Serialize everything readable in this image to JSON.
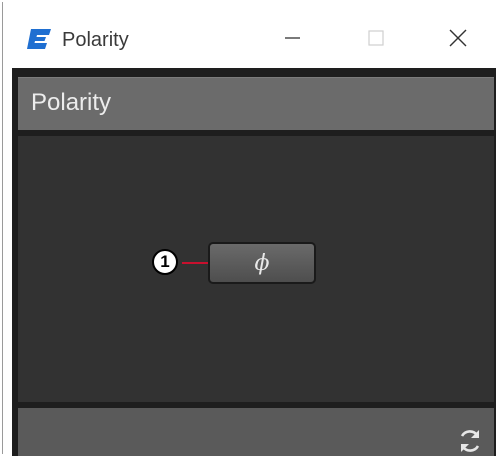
{
  "window": {
    "title": "Polarity",
    "icon": "app-e-logo-icon",
    "controls": [
      "minimize-icon",
      "maximize-icon",
      "close-icon"
    ]
  },
  "panel": {
    "header_title": "Polarity",
    "polarity_button_label": "ϕ",
    "callout_number": "1",
    "footer_icon": "refresh-icon"
  },
  "colors": {
    "accent": "#1f6fd1",
    "callout_line": "#c8102e",
    "panel_bg": "#323232",
    "header_bg": "#6b6b6b"
  }
}
